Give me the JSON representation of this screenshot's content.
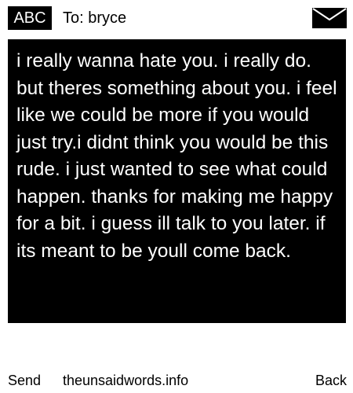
{
  "header": {
    "mode_label": "ABC",
    "recipient": "To: bryce",
    "envelope_icon": "envelope-icon"
  },
  "message": {
    "body": "i really wanna hate you. i really do. but theres something about you. i feel like we could be more if you would just try.i didnt think you would be this rude. i just wanted to see what could happen. thanks for making me happy for a bit. i guess ill talk to you later. if its meant to be youll come back."
  },
  "footer": {
    "send_label": "Send",
    "site_label": "theunsaidwords.info",
    "back_label": "Back"
  },
  "colors": {
    "background": "#ffffff",
    "message_background": "#000000",
    "message_text": "#ffffff",
    "text": "#000000"
  }
}
